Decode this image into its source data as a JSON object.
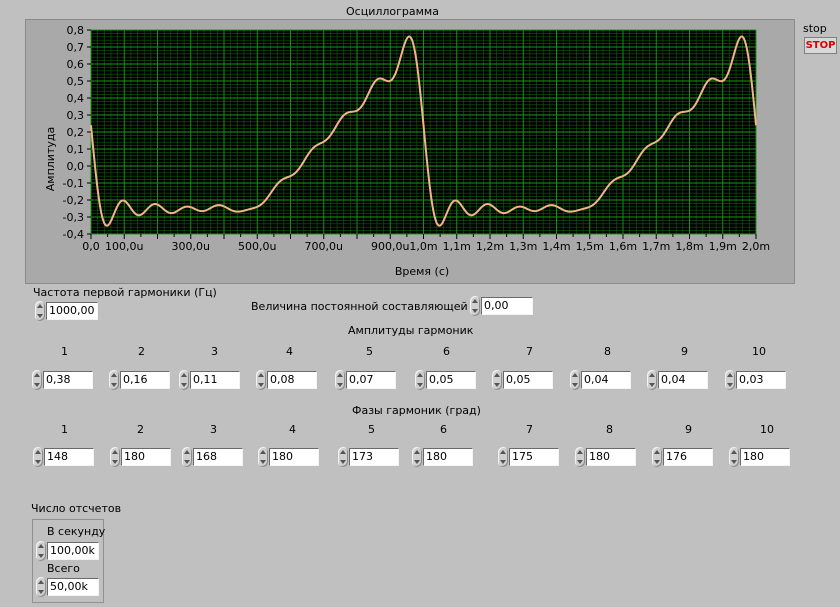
{
  "stop": {
    "label": "stop",
    "button": "STOP"
  },
  "graph": {
    "title": "Осциллограмма",
    "xlabel": "Время (с)",
    "ylabel": "Амплитуда",
    "colors": {
      "plot_bg": "#000000",
      "grid_minor": "#0c5e0c",
      "grid_major": "#169a16",
      "trace": "#f4b38a"
    }
  },
  "chart_data": {
    "type": "line",
    "title": "Осциллограмма",
    "xlabel": "Время (с)",
    "ylabel": "Амплитуда",
    "xlim": [
      0,
      0.002
    ],
    "ylim": [
      -0.4,
      0.8
    ],
    "xticks": [
      "0,0",
      "100,0u",
      "300,0u",
      "500,0u",
      "700,0u",
      "900,0u",
      "1,0m",
      "1,1m",
      "1,2m",
      "1,3m",
      "1,4m",
      "1,5m",
      "1,6m",
      "1,7m",
      "1,8m",
      "1,9m",
      "2,0m"
    ],
    "yticks": [
      "-0,4",
      "-0,3",
      "-0,2",
      "-0,1",
      "0,0",
      "0,1",
      "0,2",
      "0,3",
      "0,4",
      "0,5",
      "0,6",
      "0,7",
      "0,8"
    ],
    "grid": true,
    "signal": {
      "dc": 0.0,
      "frequency_hz": 1000,
      "amplitudes": [
        0.38,
        0.16,
        0.11,
        0.08,
        0.07,
        0.05,
        0.05,
        0.04,
        0.04,
        0.03
      ],
      "phases_deg": [
        148,
        180,
        168,
        180,
        173,
        180,
        175,
        180,
        176,
        180
      ],
      "samples_per_second": 100000,
      "total_samples": 50000
    }
  },
  "freq": {
    "label": "Частота первой гармоники (Гц)",
    "value": "1000,00"
  },
  "dc": {
    "label": "Величина постоянной составляющей",
    "value": "0,00"
  },
  "amps": {
    "title": "Амплитуды гармоник",
    "headers": [
      "1",
      "2",
      "3",
      "4",
      "5",
      "6",
      "7",
      "8",
      "9",
      "10"
    ],
    "values": [
      "0,38",
      "0,16",
      "0,11",
      "0,08",
      "0,07",
      "0,05",
      "0,05",
      "0,04",
      "0,04",
      "0,03"
    ]
  },
  "phases": {
    "title": "Фазы гармоник (град)",
    "headers": [
      "1",
      "2",
      "3",
      "4",
      "5",
      "6",
      "7",
      "8",
      "9",
      "10"
    ],
    "values": [
      "148",
      "180",
      "168",
      "180",
      "173",
      "180",
      "175",
      "180",
      "176",
      "180"
    ]
  },
  "samples": {
    "title": "Число отсчетов",
    "per_second_label": "В секунду",
    "per_second_value": "100,00k",
    "total_label": "Всего",
    "total_value": "50,00k"
  }
}
